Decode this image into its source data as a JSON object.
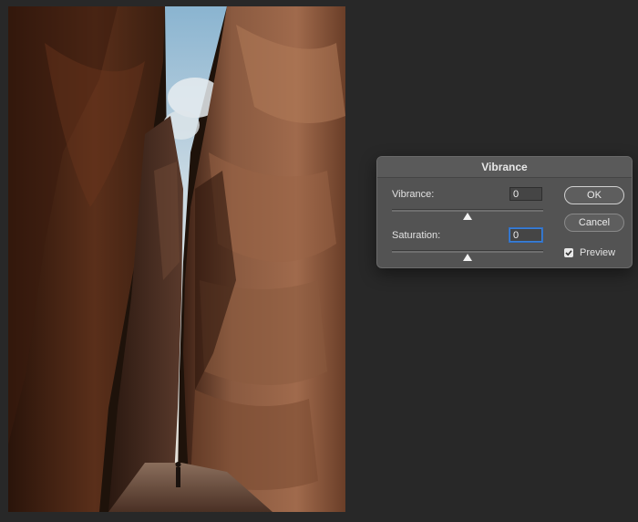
{
  "dialog": {
    "title": "Vibrance",
    "vibrance": {
      "label": "Vibrance:",
      "value": "0",
      "slider_fraction": 0.5
    },
    "saturation": {
      "label": "Saturation:",
      "value": "0",
      "slider_fraction": 0.5
    },
    "ok_label": "OK",
    "cancel_label": "Cancel",
    "preview": {
      "label": "Preview",
      "checked": true
    }
  },
  "colors": {
    "workspace": "#282828",
    "dialog_bg": "#535353",
    "focus_ring": "#3b7fd6"
  },
  "icons": {
    "preview_check": "check-icon"
  }
}
